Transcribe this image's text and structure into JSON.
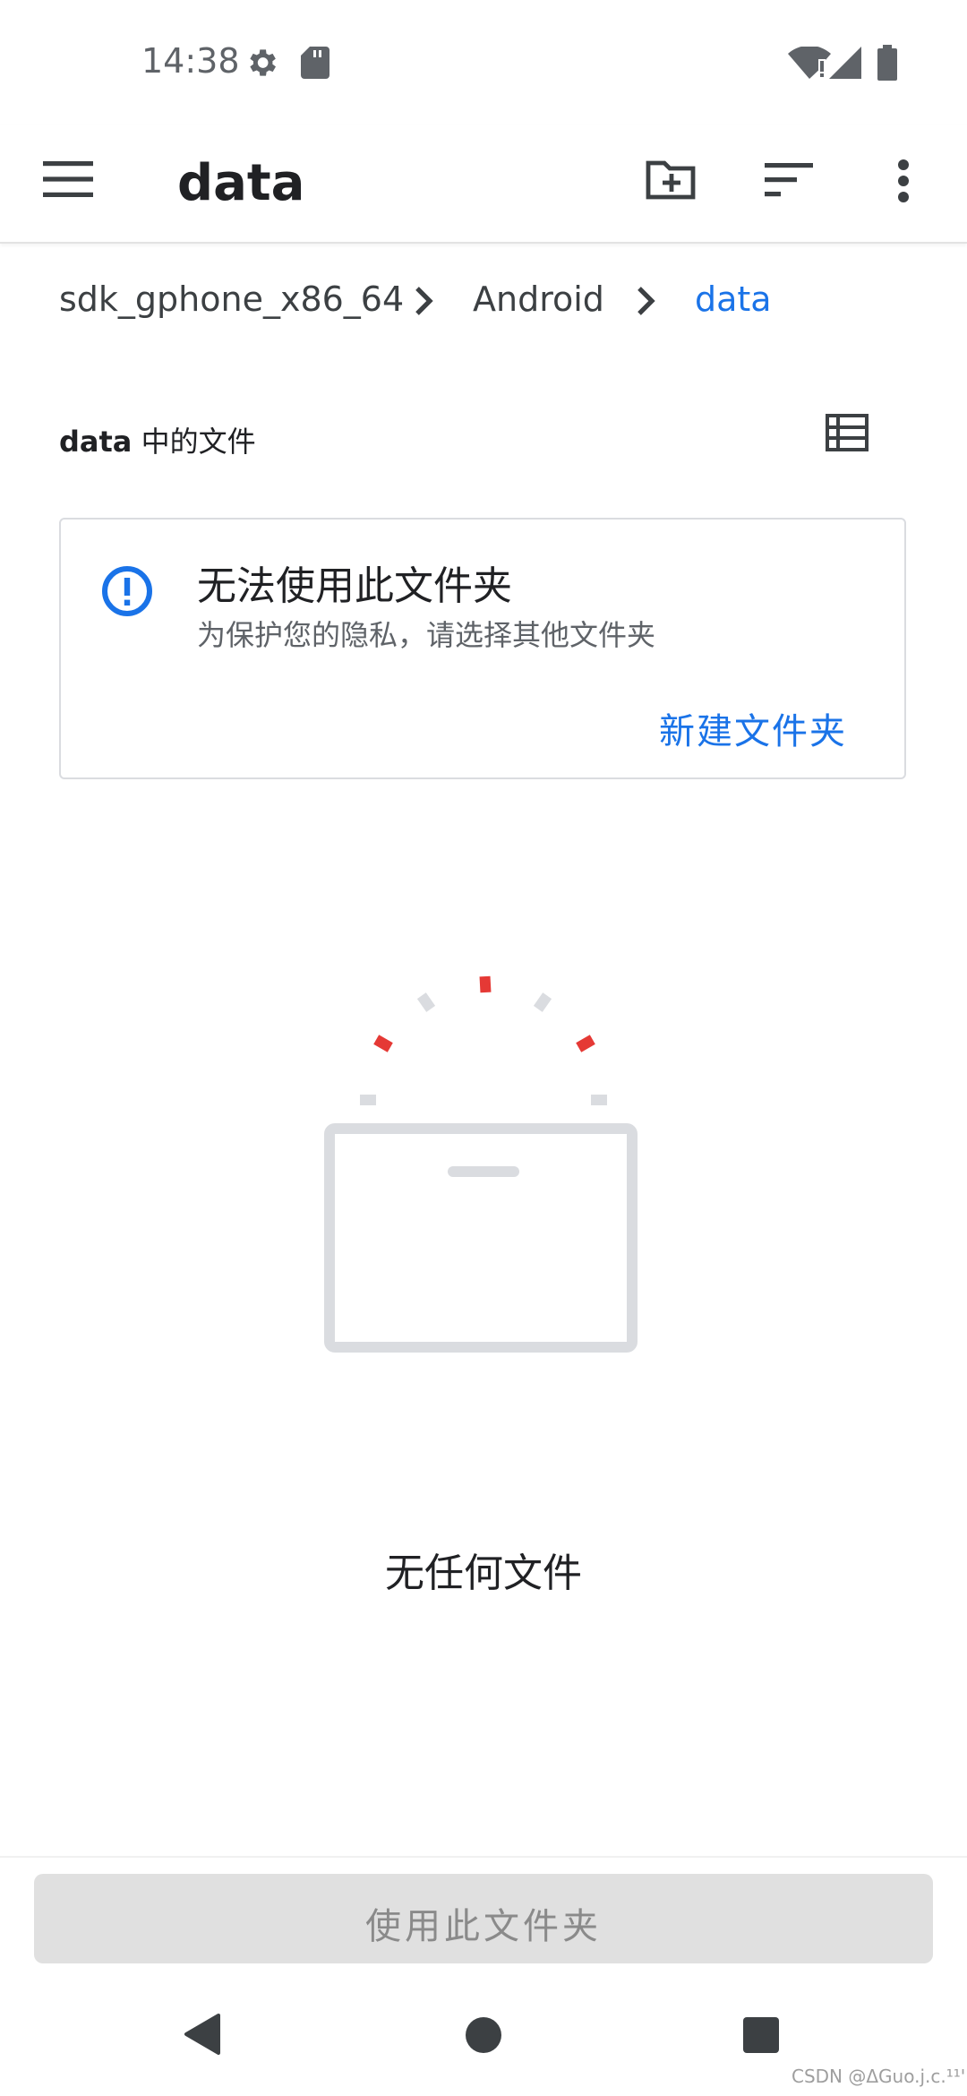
{
  "status_bar": {
    "time": "14:38",
    "icons": [
      "settings-gear-icon",
      "sd-card-icon",
      "wifi-icon",
      "signal-icon",
      "battery-icon"
    ]
  },
  "app_bar": {
    "title": "data",
    "icons": [
      "menu-icon",
      "new-folder-icon",
      "sort-icon",
      "more-options-icon"
    ]
  },
  "breadcrumb": {
    "items": [
      "sdk_gphone_x86_64",
      "Android",
      "data"
    ]
  },
  "section": {
    "folder_name": "data",
    "suffix": " 中的文件",
    "view_icon": "list-view-icon"
  },
  "info_card": {
    "title": "无法使用此文件夹",
    "subtitle": "为保护您的隐私，请选择其他文件夹",
    "action": "新建文件夹",
    "icon": "info-icon"
  },
  "empty_state": {
    "message": "无任何文件"
  },
  "bottom_button": {
    "label": "使用此文件夹",
    "enabled": false
  },
  "nav_bar": {
    "icons": [
      "back-icon",
      "home-icon",
      "recents-icon"
    ]
  },
  "watermark": "CSDN @ΔGuo.j.c.¹¹'",
  "colors": {
    "accent": "#1a73e8",
    "illustration_red": "#e53935",
    "illustration_gray": "#dadce0",
    "disabled_button": "#e0e0e0"
  }
}
